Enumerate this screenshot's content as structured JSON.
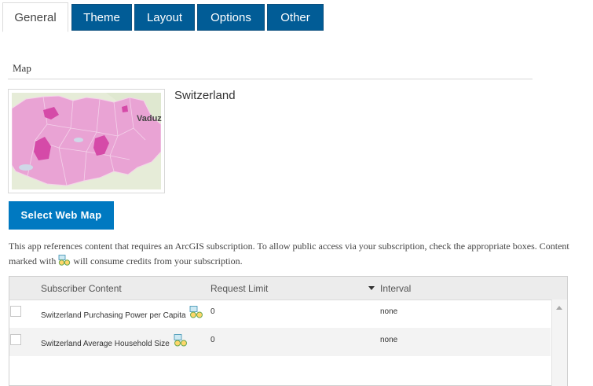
{
  "tabs": [
    {
      "label": "General",
      "active": true
    },
    {
      "label": "Theme"
    },
    {
      "label": "Layout"
    },
    {
      "label": "Options"
    },
    {
      "label": "Other"
    }
  ],
  "map_section": {
    "label": "Map",
    "title": "Switzerland",
    "thumbnail_place_label": "Vaduz",
    "select_button": "Select Web Map"
  },
  "notice": {
    "part1": "This app references content that requires an ArcGIS subscription. To allow public access via your subscription, check the appropriate boxes. Content marked with",
    "part2": "will consume credits from your subscription.",
    "icon": "credits-icon"
  },
  "subscriber_table": {
    "headers": {
      "content": "Subscriber Content",
      "limit": "Request Limit",
      "interval": "Interval"
    },
    "rows": [
      {
        "name": "Switzerland Purchasing Power per Capita",
        "limit": "0",
        "interval": "none",
        "checked": false,
        "icon": "credits-icon"
      },
      {
        "name": "Switzerland Average Household Size",
        "limit": "0",
        "interval": "none",
        "checked": false,
        "icon": "credits-icon"
      }
    ]
  },
  "colors": {
    "tab_blue": "#015c96",
    "button_blue": "#0079c1",
    "map_pink": "#e9a3d4",
    "map_magenta": "#d54aa8"
  }
}
